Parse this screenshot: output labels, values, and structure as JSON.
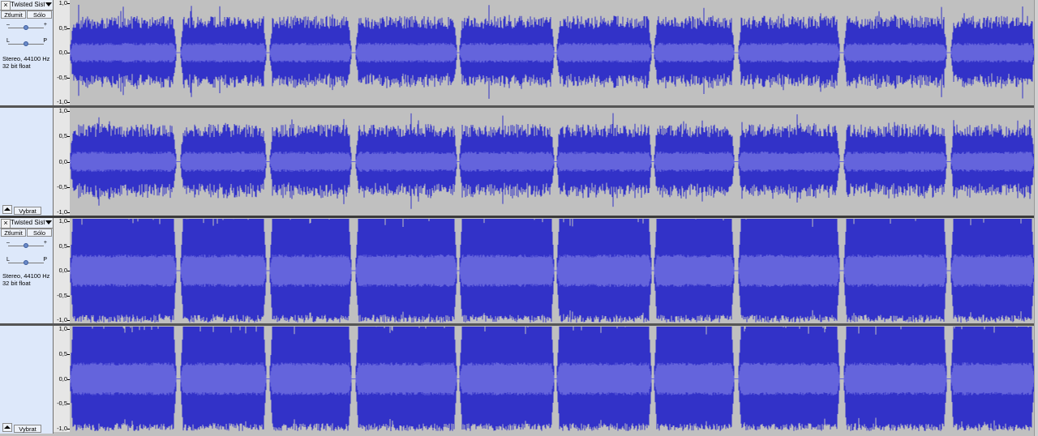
{
  "tracks": [
    {
      "name": "Twisted Sist",
      "mute_label": "Ztlumit",
      "solo_label": "Sólo",
      "gain_minus": "–",
      "gain_plus": "+",
      "pan_left": "L",
      "pan_right": "P",
      "gain_level": 0.5,
      "pan_level": 0.5,
      "format_line1": "Stereo, 44100 Hz",
      "format_line2": "32 bit float",
      "select_label": "Vybrat",
      "channel_ticks": [
        "1,0",
        "0,5",
        "0,0",
        "-0,5",
        "-1,0"
      ],
      "amplitude_style": "normal"
    },
    {
      "name": "Twisted Sist",
      "mute_label": "Ztlumit",
      "solo_label": "Sólo",
      "gain_minus": "–",
      "gain_plus": "+",
      "pan_left": "L",
      "pan_right": "P",
      "gain_level": 0.5,
      "pan_level": 0.5,
      "format_line1": "Stereo, 44100 Hz",
      "format_line2": "32 bit float",
      "select_label": "Vybrat",
      "channel_ticks": [
        "1,0",
        "0,5",
        "0,0",
        "-0,5",
        "-1,0"
      ],
      "amplitude_style": "clipped"
    }
  ],
  "colors": {
    "wave_peak": "#3232c8",
    "wave_rms": "#6464dc",
    "background": "#c0c0c0"
  }
}
